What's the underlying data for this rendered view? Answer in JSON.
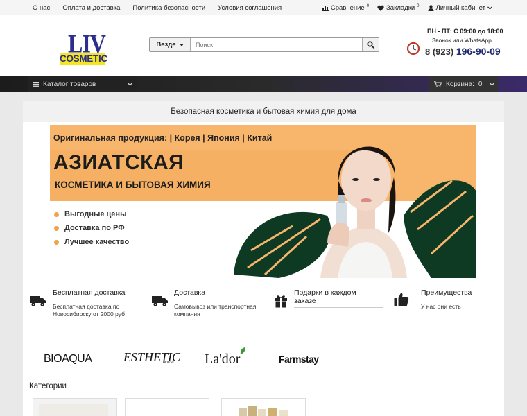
{
  "topbar": {
    "links": [
      "О нас",
      "Оплата и доставка",
      "Политика безопасности",
      "Условия соглашения"
    ],
    "compare_label": "Сравнение",
    "compare_count": "0",
    "bookmarks_label": "Закладки",
    "bookmarks_count": "0",
    "account_label": "Личный кабинет"
  },
  "logo": {
    "line1": "LIV",
    "line2": "COSMETIC"
  },
  "search": {
    "scope": "Везде",
    "placeholder": "Поиск"
  },
  "contact": {
    "hours": "ПН - ПТ: С 09:00 до 18:00",
    "note": "Звонок или WhatsApp",
    "phone_code": "8 (923)",
    "phone_number": "196-90-09"
  },
  "nav": {
    "catalog_label": "Каталог товаров",
    "cart_label": "Корзина:",
    "cart_count": "0"
  },
  "tagline": "Безопасная косметика и бытовая химия для дома",
  "banner": {
    "line1": "Оригинальная продукция: | Корея | Япония | Китай",
    "line2": "АЗИАТСКАЯ",
    "line3": "КОСМЕТИКА И БЫТОВАЯ ХИМИЯ",
    "bullets": [
      "Выгодные цены",
      "Доставка по РФ",
      "Лучшее качество"
    ]
  },
  "features": [
    {
      "title": "Бесплатная доставка",
      "desc_lines": [
        "Бесплатная доставка по",
        "Новосибирску от 2000 руб"
      ],
      "icon": "truck-icon"
    },
    {
      "title": "Доставка",
      "desc_lines": [
        "Самовывоз или транспортная",
        "компания"
      ],
      "icon": "truck-icon"
    },
    {
      "title_lines": [
        "Подарки в каждом",
        "заказе"
      ],
      "desc_lines": [],
      "icon": "gift-icon"
    },
    {
      "title": "Преимущества",
      "desc_lines": [
        "У нас они есть"
      ],
      "icon": "thumbs-up-icon"
    }
  ],
  "brands": [
    "BIOAQUA",
    "ESTHETIC",
    "HOUSE",
    "La'dor",
    "Farmstay"
  ],
  "categories": {
    "title": "Категории"
  },
  "colors": {
    "nav_dark": "#1c1c1c",
    "nav_accent": "#3a2a6a",
    "banner_orange": "#f8b56c",
    "logo_blue": "#2b2e8c",
    "logo_yellow": "#f4e61c",
    "phone_blue": "#1f2a6b"
  }
}
